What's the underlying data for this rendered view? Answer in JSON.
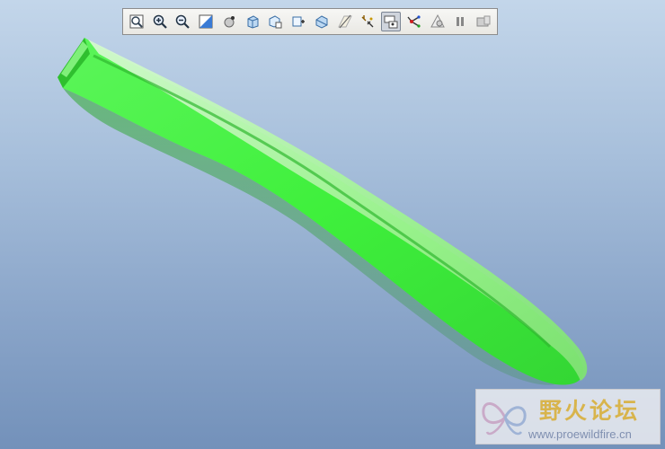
{
  "toolbar": {
    "buttons": [
      {
        "id": "zoom-fit",
        "icon": "refit-icon",
        "active": false
      },
      {
        "id": "zoom-in",
        "icon": "zoom-in-icon",
        "active": false
      },
      {
        "id": "zoom-out",
        "icon": "zoom-out-icon",
        "active": false
      },
      {
        "id": "repaint",
        "icon": "repaint-icon",
        "active": false
      },
      {
        "id": "spin-center",
        "icon": "spin-center-icon",
        "active": false
      },
      {
        "id": "display-style",
        "icon": "display-style-icon",
        "active": false
      },
      {
        "id": "saved-views",
        "icon": "saved-views-icon",
        "active": false
      },
      {
        "id": "view-manager",
        "icon": "view-manager-icon",
        "active": false
      },
      {
        "id": "section",
        "icon": "section-view-icon",
        "active": false
      },
      {
        "id": "datum-planes",
        "icon": "datum-plane-icon",
        "active": false
      },
      {
        "id": "datum-axes",
        "icon": "datum-axis-icon",
        "active": false
      },
      {
        "id": "datum-points",
        "icon": "datum-point-display-icon",
        "active": true
      },
      {
        "id": "csys",
        "icon": "coordinate-system-icon",
        "active": false
      },
      {
        "id": "annotations",
        "icon": "annotation-warning-icon",
        "active": false
      },
      {
        "id": "pause",
        "icon": "pause-icon",
        "active": false
      },
      {
        "id": "render",
        "icon": "render-icon",
        "active": false
      }
    ]
  },
  "model": {
    "color": "#44f044",
    "highlight": "#b6f7b0",
    "shadow": "#2fae2f"
  },
  "viewport": {
    "bg_top": "#c3d6ea",
    "bg_bottom": "#7391ba"
  },
  "watermark": {
    "logo": "proewildfire-butterfly-logo",
    "title": "野火论坛",
    "url": "www.proewildfire.cn"
  }
}
